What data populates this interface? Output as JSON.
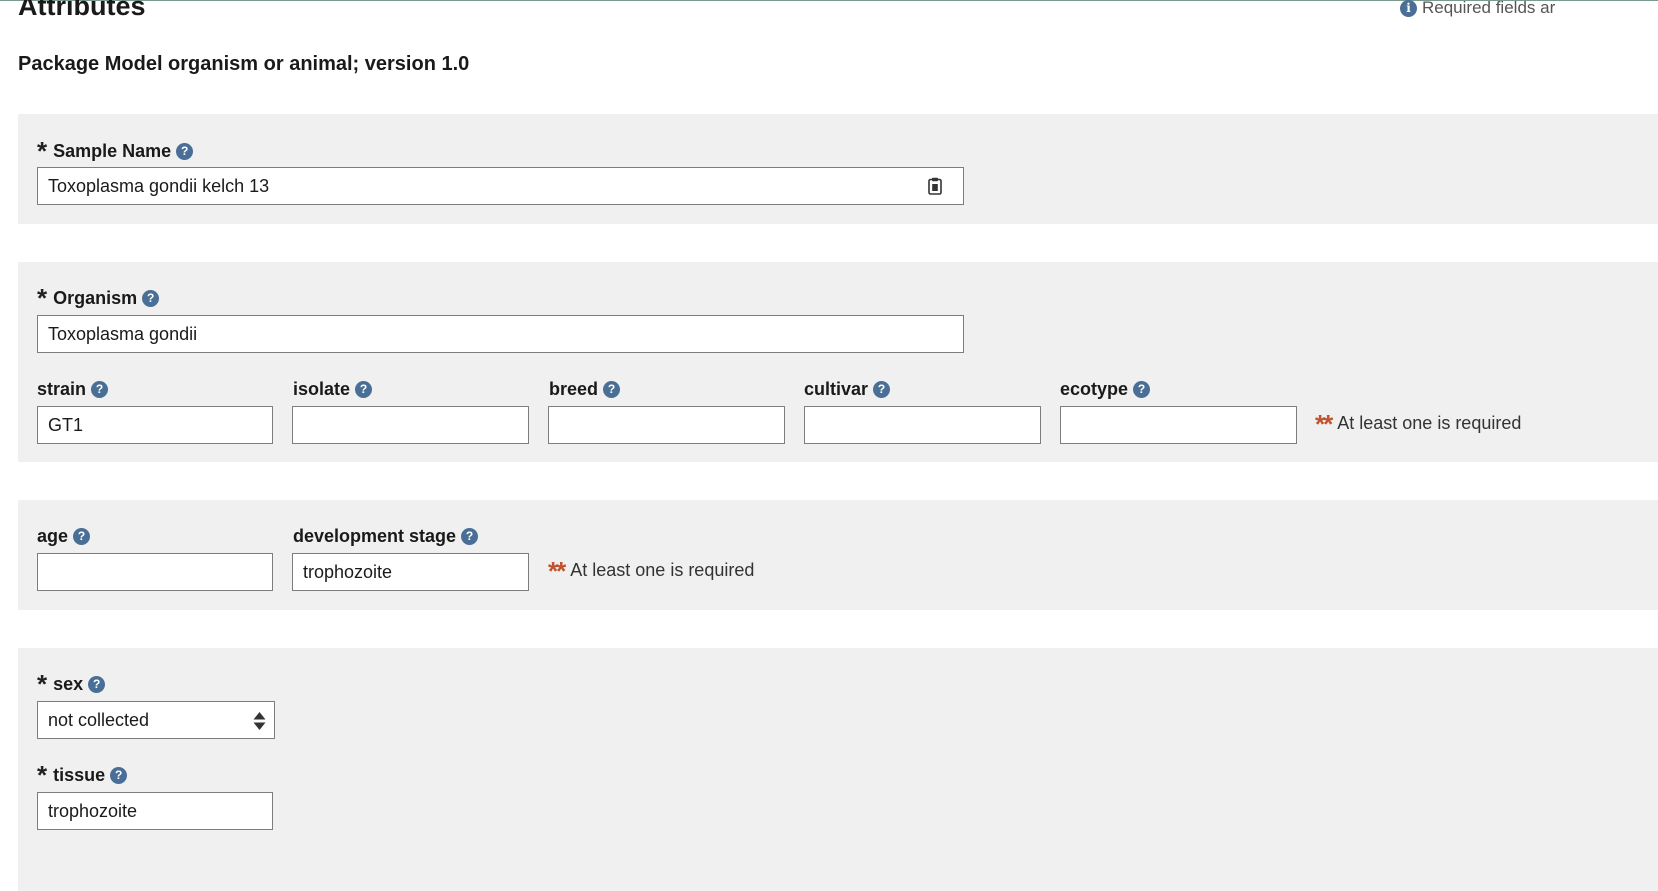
{
  "header": {
    "title": "Attributes",
    "required_note": "Required fields ar"
  },
  "package": {
    "title": "Package Model organism or animal; version 1.0"
  },
  "fields": {
    "sample_name": {
      "label": "Sample Name",
      "value": "Toxoplasma gondii kelch 13"
    },
    "organism": {
      "label": "Organism",
      "value": "Toxoplasma gondii"
    },
    "strain": {
      "label": "strain",
      "value": "GT1"
    },
    "isolate": {
      "label": "isolate",
      "value": ""
    },
    "breed": {
      "label": "breed",
      "value": ""
    },
    "cultivar": {
      "label": "cultivar",
      "value": ""
    },
    "ecotype": {
      "label": "ecotype",
      "value": ""
    },
    "age": {
      "label": "age",
      "value": ""
    },
    "development_stage": {
      "label": "development stage",
      "value": "trophozoite"
    },
    "sex": {
      "label": "sex",
      "value": "not collected"
    },
    "tissue": {
      "label": "tissue",
      "value": "trophozoite"
    }
  },
  "messages": {
    "group_required": "At least one is required",
    "required_mark": "*",
    "group_required_mark": "**"
  },
  "icons": {
    "help": "question-circle-icon",
    "info": "info-circle-icon",
    "clipboard": "clipboard-icon",
    "select_arrows": "sort-arrows-icon"
  },
  "colors": {
    "panel_bg": "#f0f0f0",
    "help_icon": "#4a6f96",
    "group_required_star": "#c0522d"
  }
}
